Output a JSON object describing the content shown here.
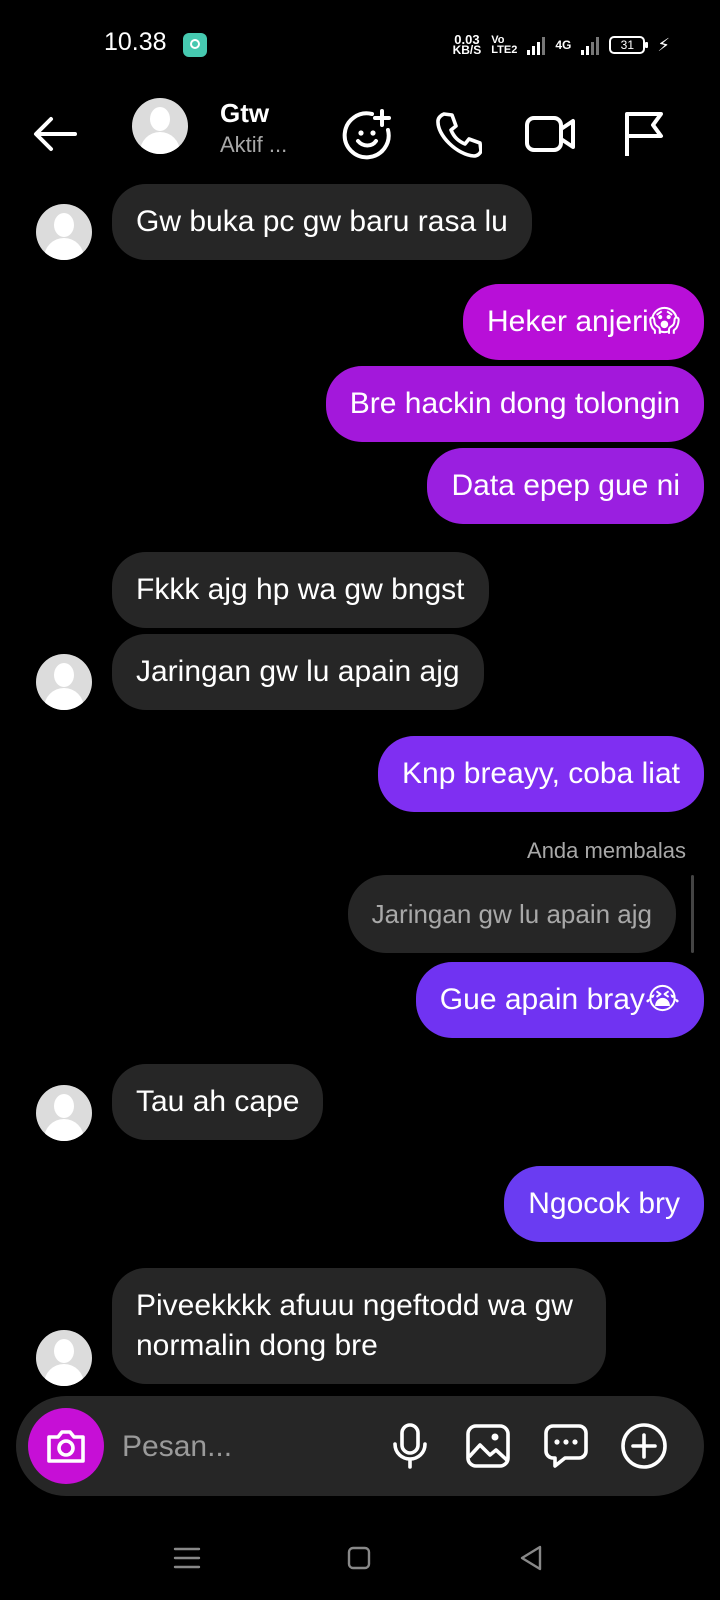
{
  "status_bar": {
    "time": "10.38",
    "net_speed_value": "0.03",
    "net_speed_unit": "KB/S",
    "volte_top": "Vo",
    "volte_bottom": "LTE2",
    "network": "4G",
    "battery": "31"
  },
  "header": {
    "contact_name": "Gtw",
    "contact_status": "Aktif ..."
  },
  "messages": [
    {
      "dir": "in",
      "text": "Gw buka pc gw baru rasa lu"
    },
    {
      "dir": "out",
      "text": "Heker anjeri",
      "emoji": "😱"
    },
    {
      "dir": "out",
      "text": "Bre hackin dong tolongin"
    },
    {
      "dir": "out",
      "text": "Data epep gue ni"
    },
    {
      "dir": "in",
      "text": "Fkkk ajg hp wa gw bngst"
    },
    {
      "dir": "in",
      "text": "Jaringan gw lu apain ajg"
    },
    {
      "dir": "out",
      "text": "Knp breayy, coba liat"
    },
    {
      "dir": "out",
      "text": "Gue apain bray",
      "emoji": "😭"
    },
    {
      "dir": "in",
      "text": "Tau ah cape"
    },
    {
      "dir": "out",
      "text": "Ngocok bry"
    },
    {
      "dir": "in",
      "text": "Piveekkkk afuuu ngeftodd wa gw normalin dong bre"
    }
  ],
  "reply": {
    "label": "Anda membalas",
    "quoted": "Jaringan gw lu apain ajg"
  },
  "composer": {
    "placeholder": "Pesan..."
  },
  "colors": {
    "outgoing_pink": "#b80fd8",
    "outgoing_purple_mid": "#8a2cf0",
    "outgoing_violet": "#7033f2",
    "outgoing_indigo": "#6a3cf2",
    "incoming": "#262626",
    "camera": "#c60fd6"
  },
  "icons": {
    "back": "arrow-left-icon",
    "effects": "sticker-add-icon",
    "call": "phone-icon",
    "video": "video-camera-icon",
    "report": "flag-icon",
    "camera": "camera-icon",
    "mic": "microphone-icon",
    "gallery": "image-icon",
    "chat": "chat-bubble-icon",
    "add": "plus-circle-icon"
  }
}
